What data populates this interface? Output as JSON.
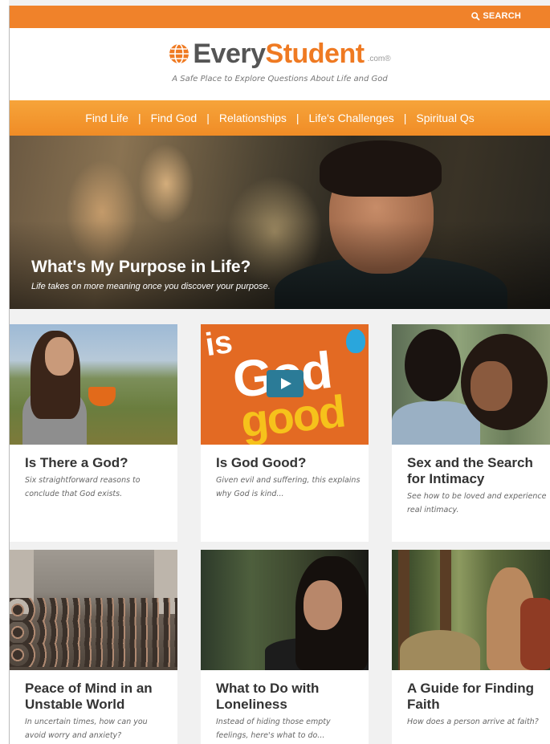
{
  "header": {
    "search_label": "SEARCH",
    "logo": {
      "part1": "Every",
      "part2": "Student",
      "suffix": ".com®"
    },
    "tagline": "A Safe Place to Explore Questions About Life and God"
  },
  "nav": {
    "items": [
      {
        "label": "Find Life"
      },
      {
        "label": "Find God"
      },
      {
        "label": "Relationships"
      },
      {
        "label": "Life's Challenges"
      },
      {
        "label": "Spiritual Qs"
      }
    ],
    "separator": "|"
  },
  "hero": {
    "title": "What's My Purpose in Life?",
    "subtitle": "Life takes on more meaning once you discover your purpose."
  },
  "cards": [
    {
      "title": "Is There a God?",
      "desc": "Six straightforward reasons to conclude that God exists.",
      "image": "woman-with-mug"
    },
    {
      "title": "Is God Good?",
      "desc": "Given evil and suffering, this explains why God is kind...",
      "image": "is-god-good-video",
      "image_text": [
        "is",
        "God",
        "good"
      ]
    },
    {
      "title": "Sex and the Search for Intimacy",
      "desc": "See how to be loved and experience real intimacy.",
      "image": "couple-embracing"
    },
    {
      "title": "Peace of Mind in an Unstable World",
      "desc": "In uncertain times, how can you avoid worry and anxiety?",
      "image": "city-crowd"
    },
    {
      "title": "What to Do with Loneliness",
      "desc": "Instead of hiding those empty feelings, here's what to do...",
      "image": "pensive-woman"
    },
    {
      "title": "A Guide for Finding Faith",
      "desc": "How does a person arrive at faith?",
      "image": "hiker-in-forest"
    }
  ],
  "colors": {
    "accent": "#f0822a",
    "nav_gradient_top": "#f6a43a",
    "text": "#333333"
  }
}
